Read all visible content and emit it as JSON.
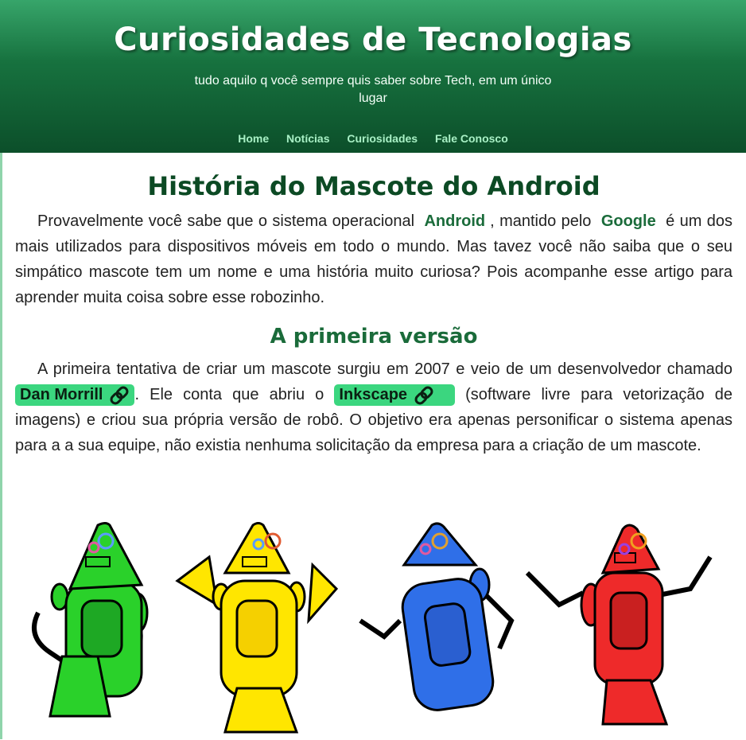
{
  "header": {
    "title": "Curiosidades de Tecnologias",
    "tagline": "tudo aquilo q você sempre quis saber sobre Tech, em um único lugar",
    "nav": [
      "Home",
      "Notícias",
      "Curiosidades",
      "Fale Conosco"
    ]
  },
  "article": {
    "title": "História do Mascote do Android",
    "intro": {
      "part1": "Provavelmente você sabe que o sistema operacional",
      "android": "Android",
      "part2": ", mantido pelo",
      "google": "Google",
      "part3": "é um dos mais utilizados para dispositivos móveis em todo o mundo. Mas tavez você não saiba que o seu simpático mascote tem um nome e uma história muito curiosa? Pois acompanhe esse artigo para aprender muita coisa sobre esse robozinho."
    },
    "section1": {
      "heading": "A primeira versão",
      "part1": "A primeira tentativa de criar um mascote surgiu em 2007 e veio de um desenvolvedor chamado",
      "link1": "Dan Morrill",
      "part2": ". Ele conta que abriu o",
      "link2": "Inkscape",
      "part3": "(software livre para vetorização de imagens) e criou sua própria versão de robô. O objetivo era apenas personificar o sistema apenas para a a sua equipe, não existia nenhuma solicitação da empresa para a criação de um mascote."
    }
  },
  "colors": {
    "header_top": "#37a56a",
    "header_bottom": "#0c4f2a",
    "nav_link": "#a8f0c5",
    "heading": "#0c4a24",
    "pill": "#3bd67f",
    "robots": [
      "#2ad12a",
      "#ffe600",
      "#2f6fe8",
      "#ee2a2a"
    ]
  },
  "icons": [
    "link-icon"
  ]
}
